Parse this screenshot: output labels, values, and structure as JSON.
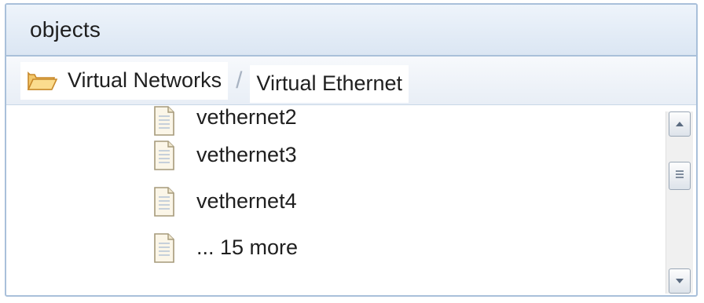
{
  "panel": {
    "title": "objects"
  },
  "breadcrumb": {
    "items": [
      {
        "label": "Virtual Networks",
        "icon": "folder-open-icon"
      },
      {
        "label": "Virtual Ethernet"
      }
    ],
    "separator": "/"
  },
  "list": {
    "items": [
      {
        "label": "vethernet2",
        "icon": "document-icon"
      },
      {
        "label": "vethernet3",
        "icon": "document-icon"
      },
      {
        "label": "vethernet4",
        "icon": "document-icon"
      },
      {
        "label": "... 15 more",
        "icon": "document-icon"
      }
    ]
  },
  "colors": {
    "border": "#a9c0da",
    "folder": "#f0b64a",
    "text": "#1f1f1f"
  }
}
